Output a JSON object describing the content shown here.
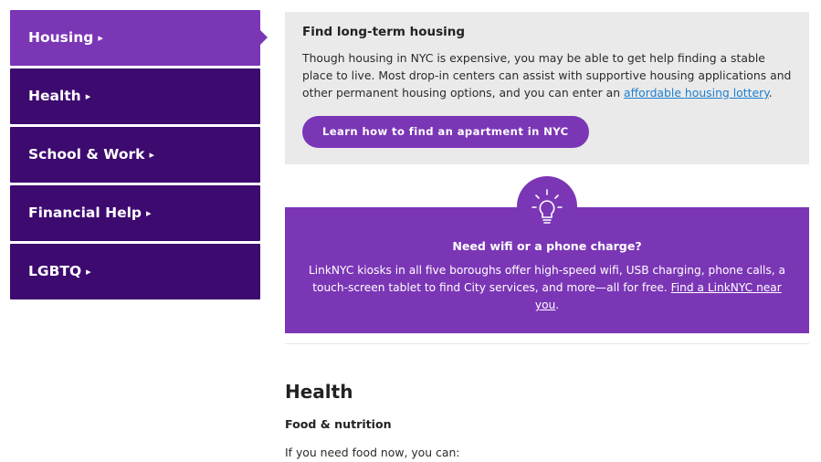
{
  "sidebar": {
    "items": [
      {
        "label": "Housing",
        "active": true
      },
      {
        "label": "Health",
        "active": false
      },
      {
        "label": "School & Work",
        "active": false
      },
      {
        "label": "Financial Help",
        "active": false
      },
      {
        "label": "LGBTQ",
        "active": false
      }
    ],
    "caret": "▸"
  },
  "housing": {
    "title": "Find long-term housing",
    "text_before_link": "Though housing in NYC is expensive, you may be able to get help finding a stable place to live. Most drop-in centers can assist with supportive housing applications and other permanent housing options, and you can enter an ",
    "link_label": "affordable housing lottery",
    "text_after_link": ".",
    "button_label": "Learn how to find an apartment in NYC"
  },
  "wifi": {
    "icon": "lightbulb-icon",
    "title": "Need wifi or a phone charge?",
    "text_before_link": "LinkNYC kiosks in all five boroughs offer high-speed wifi, USB charging, phone calls, a touch-screen tablet to find City services, and more—all for free. ",
    "link_label": "Find a LinkNYC near you",
    "text_after_link": "."
  },
  "health": {
    "title": "Health",
    "subtitle": "Food & nutrition",
    "intro": "If you need food now, you can:"
  },
  "colors": {
    "nav_dark": "#3d0a70",
    "accent_purple": "#7b36b6",
    "card_gray": "#eaeaea",
    "link_blue": "#1c7fd0"
  }
}
